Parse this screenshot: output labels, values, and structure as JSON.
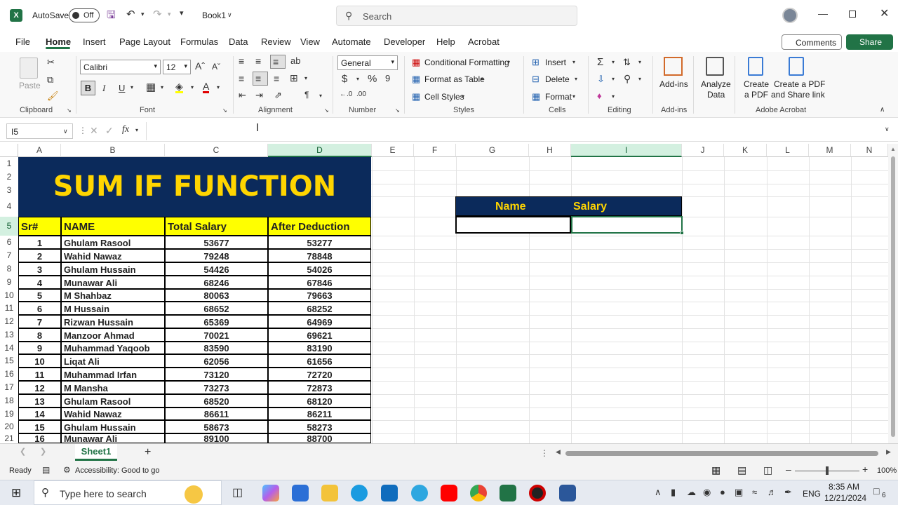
{
  "titlebar": {
    "autosave_label": "AutoSave",
    "autosave_state": "Off",
    "workbook": "Book1",
    "search_placeholder": "Search"
  },
  "menu": {
    "items": [
      "File",
      "Home",
      "Insert",
      "Page Layout",
      "Formulas",
      "Data",
      "Review",
      "View",
      "Automate",
      "Developer",
      "Help",
      "Acrobat"
    ],
    "comments": "Comments",
    "share": "Share"
  },
  "ribbon": {
    "clipboard": {
      "label": "Clipboard",
      "paste": "Paste"
    },
    "font": {
      "label": "Font",
      "name": "Calibri",
      "size": "12"
    },
    "alignment": {
      "label": "Alignment"
    },
    "number": {
      "label": "Number",
      "format": "General"
    },
    "styles": {
      "label": "Styles",
      "cond": "Conditional Formatting",
      "table": "Format as Table",
      "cell": "Cell Styles"
    },
    "cells": {
      "label": "Cells",
      "insert": "Insert",
      "delete": "Delete",
      "format": "Format"
    },
    "editing": {
      "label": "Editing"
    },
    "addins": {
      "label": "Add-ins",
      "btn": "Add-ins",
      "analyze1": "Analyze",
      "analyze2": "Data"
    },
    "acrobat": {
      "label": "Adobe Acrobat",
      "c1a": "Create",
      "c1b": "a PDF",
      "c2a": "Create a PDF",
      "c2b": "and Share link"
    }
  },
  "formula": {
    "namebox": "I5",
    "content": ""
  },
  "columns": [
    "A",
    "B",
    "C",
    "D",
    "E",
    "F",
    "G",
    "H",
    "I",
    "J",
    "K",
    "L",
    "M",
    "N"
  ],
  "rows": [
    "1",
    "2",
    "3",
    "4",
    "5",
    "6",
    "7",
    "8",
    "9",
    "10",
    "11",
    "12",
    "13",
    "14",
    "15",
    "16",
    "17",
    "18",
    "19",
    "20",
    "21"
  ],
  "sheet": {
    "title": "SUM IF FUNCTION",
    "headers": [
      "Sr#",
      "NAME",
      "Total Salary",
      "After Deduction"
    ],
    "data": [
      [
        "1",
        "Ghulam Rasool",
        "53677",
        "53277"
      ],
      [
        "2",
        "Wahid Nawaz",
        "79248",
        "78848"
      ],
      [
        "3",
        "Ghulam Hussain",
        "54426",
        "54026"
      ],
      [
        "4",
        "Munawar Ali",
        "68246",
        "67846"
      ],
      [
        "5",
        "M Shahbaz",
        "80063",
        "79663"
      ],
      [
        "6",
        "M Hussain",
        "68652",
        "68252"
      ],
      [
        "7",
        "Rizwan Hussain",
        "65369",
        "64969"
      ],
      [
        "8",
        "Manzoor Ahmad",
        "70021",
        "69621"
      ],
      [
        "9",
        "Muhammad Yaqoob",
        "83590",
        "83190"
      ],
      [
        "10",
        "Liqat Ali",
        "62056",
        "61656"
      ],
      [
        "11",
        "Muhammad Irfan",
        "73120",
        "72720"
      ],
      [
        "12",
        "M Mansha",
        "73273",
        "72873"
      ],
      [
        "13",
        "Ghulam Rasool",
        "68520",
        "68120"
      ],
      [
        "14",
        "Wahid Nawaz",
        "86611",
        "86211"
      ],
      [
        "15",
        "Ghulam Hussain",
        "58673",
        "58273"
      ],
      [
        "16",
        "Munawar Ali",
        "89100",
        "88700"
      ]
    ],
    "lookup_headers": [
      "Name",
      "Salary"
    ]
  },
  "tabs": {
    "sheet": "Sheet1",
    "add": "+"
  },
  "status": {
    "ready": "Ready",
    "accessibility": "Accessibility: Good to go",
    "zoom": "100%"
  },
  "taskbar": {
    "search": "Type here to search",
    "lang": "ENG",
    "time": "8:35 AM",
    "date": "12/21/2024",
    "notif": "6"
  },
  "colors": {
    "title_bg": "#0b2a5b",
    "title_fg": "#ffd500",
    "header_yellow": "#ffff00",
    "excel_green": "#217346"
  }
}
